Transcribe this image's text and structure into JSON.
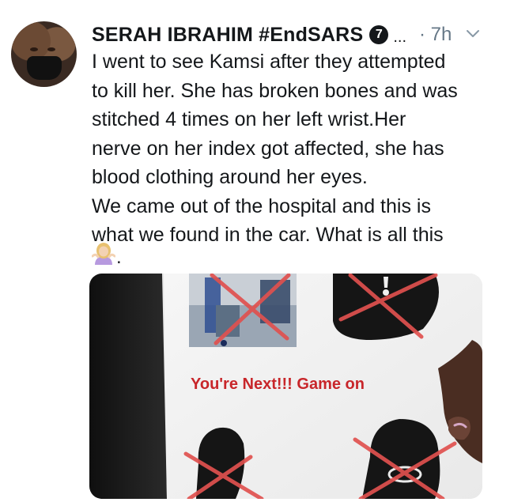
{
  "tweet": {
    "author_name": "SERAH IBRAHIM #EndSARS",
    "badge_count": "7",
    "more": "...",
    "timestamp": "· 7h",
    "text_lines": [
      "I went to see Kamsi after they attempted",
      "to kill her. She has broken bones and was",
      "stitched 4 times on her left wrist.Her",
      "nerve on her index got affected, she has",
      "blood clothing around her eyes.",
      "We came out of the hospital and this is",
      "what we found in the car. What is all this"
    ],
    "trailing_punct": ".",
    "emoji": "woman-shrugging-emoji"
  },
  "media": {
    "paper_text": "You're Next!!! Game on",
    "colors": {
      "cross_red": "#e0514f",
      "text_red": "#c8262a"
    }
  },
  "colors": {
    "text": "#14171a",
    "muted": "#657786"
  }
}
